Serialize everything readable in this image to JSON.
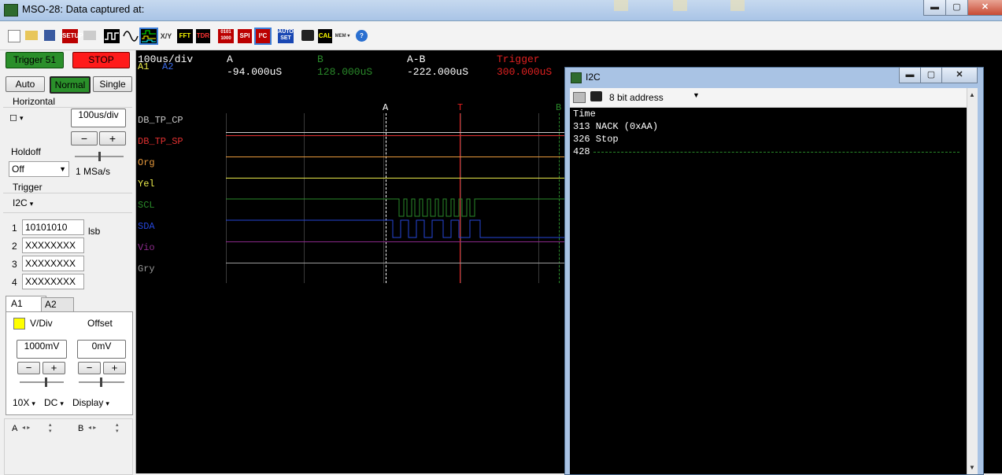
{
  "window": {
    "title": "MSO-28: Data captured at:",
    "min": "▬",
    "max": "▢",
    "close": "✕"
  },
  "toolbar": {
    "icons": [
      "new-icon",
      "open-icon",
      "save-icon",
      "setup",
      "print-icon",
      "scope-mode",
      "sine-mode",
      "logic-mode",
      "xy-mode",
      "fft",
      "tdr",
      "digital-mode",
      "spi",
      "i2c",
      "auto-set",
      "camera-icon",
      "calibrate",
      "memory",
      "help-icon"
    ],
    "setup": "SETUP",
    "fft": "FFT",
    "tdr": "TDR",
    "spi": "SPI",
    "i2c": "I²C",
    "auto_set": "AUTO SET",
    "cal": "CAL",
    "mem": "MEM",
    "help": "?"
  },
  "left": {
    "trigger_status": "Trigger 51",
    "stop": "STOP",
    "modes": {
      "auto": "Auto",
      "normal": "Normal",
      "single": "Single"
    },
    "horizontal": {
      "label": "Horizontal",
      "timebase": "100us/div",
      "minus": "−",
      "plus": "+",
      "holdoff": "Holdoff",
      "holdoff_value": "Off",
      "rate": "1 MSa/s"
    },
    "trigger": {
      "label": "Trigger",
      "source": "I2C",
      "rows": [
        {
          "n": "1",
          "value": "10101010"
        },
        {
          "n": "2",
          "value": "XXXXXXXX"
        },
        {
          "n": "3",
          "value": "XXXXXXXX"
        },
        {
          "n": "4",
          "value": "XXXXXXXX"
        }
      ],
      "order": "lsb"
    },
    "tabs": {
      "a1": "A1",
      "a2": "A2"
    },
    "analog": {
      "vdiv": "V/Div",
      "offset": "Offset",
      "vdiv_value": "1000mV",
      "offset_value": "0mV",
      "probe": "10X",
      "coupling": "DC",
      "display": "Display",
      "cursor_a": "A",
      "cursor_b": "B"
    }
  },
  "scope": {
    "timebase": "100us/div",
    "a1": "A1",
    "a2": "A2",
    "cursor_a_label": "A",
    "cursor_a_value": "-94.000uS",
    "cursor_b_label": "B",
    "cursor_b_value": "128.000uS",
    "delta_label": "A-B",
    "delta_value": "-222.000uS",
    "trigger_label": "Trigger",
    "trigger_value": "300.000uS",
    "marker_a": "A",
    "marker_t": "T",
    "marker_b": "B",
    "channels": [
      {
        "name": "DB_TP_CP",
        "color": "#c8c8c8"
      },
      {
        "name": "DB_TP_SP",
        "color": "#e03030"
      },
      {
        "name": "Org",
        "color": "#e89a3c"
      },
      {
        "name": "Yel",
        "color": "#e8e84a"
      },
      {
        "name": "SCL",
        "color": "#2a8a2a"
      },
      {
        "name": "SDA",
        "color": "#2646d8"
      },
      {
        "name": "Vio",
        "color": "#8a2a8a"
      },
      {
        "name": "Gry",
        "color": "#9a9a9a"
      }
    ]
  },
  "i2c": {
    "title": "I2C",
    "address_mode": "8 bit address",
    "rows": [
      "Time",
      "313 NACK (0xAA)",
      "326 Stop",
      "428"
    ]
  }
}
